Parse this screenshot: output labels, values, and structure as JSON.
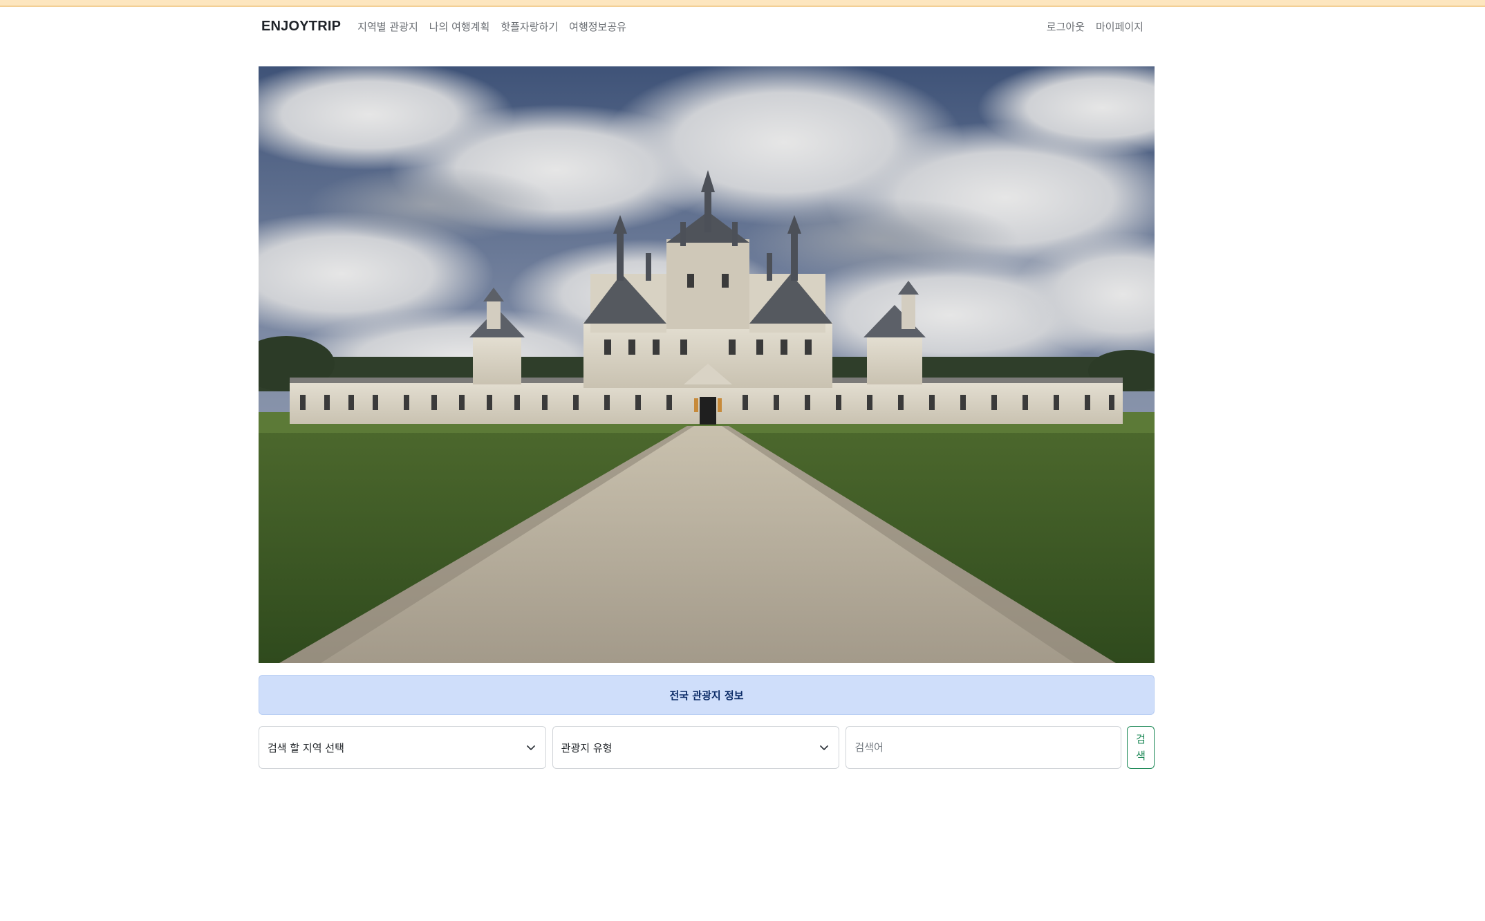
{
  "header": {
    "brand": "ENJOYTRIP",
    "nav_left": [
      "지역별 관광지",
      "나의 여행계획",
      "핫플자랑하기",
      "여행정보공유"
    ],
    "nav_right": [
      "로그아웃",
      "마이페이지"
    ]
  },
  "hero": {
    "image": "castle-photo"
  },
  "banner": {
    "text": "전국 관광지 정보"
  },
  "search": {
    "region_select": "검색 할 지역 선택",
    "type_select": "관광지 유형",
    "keyword_placeholder": "검색어",
    "keyword_value": "",
    "button_label": "검색"
  },
  "colors": {
    "top_stripe": "#fde6bf",
    "banner_bg": "#cfdefa",
    "banner_text": "#0a2a66",
    "button_accent": "#198754"
  }
}
